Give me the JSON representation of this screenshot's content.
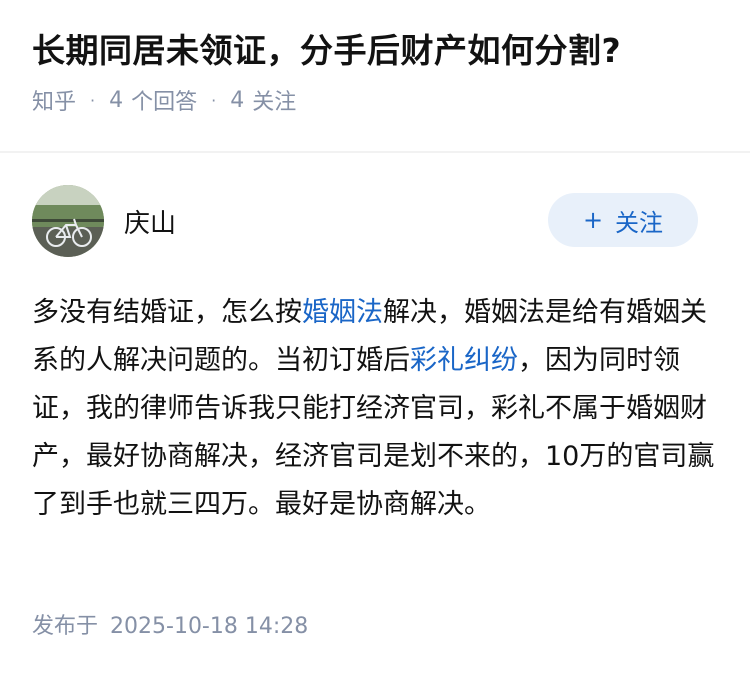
{
  "question": {
    "title": "长期同居未领证，分手后财产如何分割?",
    "source": "知乎",
    "answers_count": "4",
    "answers_label": "个回答",
    "followers_count": "4",
    "followers_label": "关注"
  },
  "answer": {
    "author_name": "庆山",
    "follow_button_plus": "+",
    "follow_button_label": "关注",
    "body": [
      {
        "text": "多没有结婚证，怎么按",
        "link": false
      },
      {
        "text": "婚姻法",
        "link": true
      },
      {
        "text": "解决，婚姻法是给有婚姻关系的人解决问题的。当初订婚后",
        "link": false
      },
      {
        "text": "彩礼纠纷",
        "link": true
      },
      {
        "text": "，因为同时领证，我的律师告诉我只能打经济官司，彩礼不属于婚姻财产，最好协商解决，经济官司是划不来的，10万的官司赢了到手也就三四万。最好是协商解决。",
        "link": false
      }
    ],
    "publish_label": "发布于",
    "publish_time": "2025-10-18 14:28"
  },
  "colors": {
    "link": "#1a66c7",
    "meta": "#8590a6",
    "follow_bg": "#e8f0fa"
  }
}
